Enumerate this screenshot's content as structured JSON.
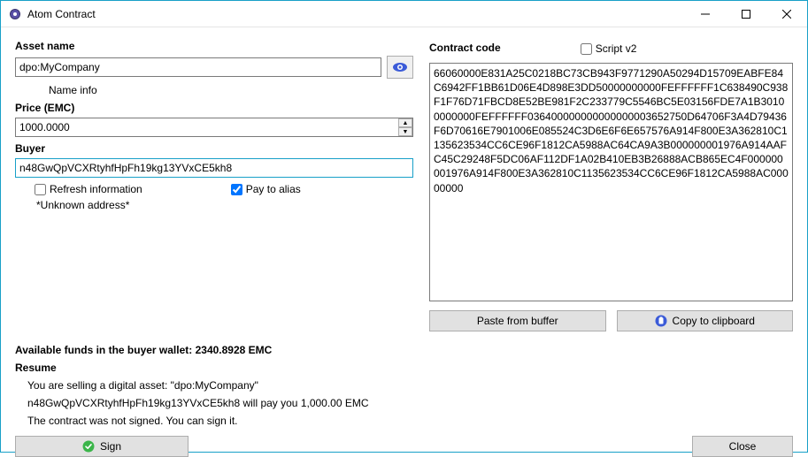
{
  "window": {
    "title": "Atom Contract",
    "minimize": "—",
    "maximize": "□",
    "close": "✕"
  },
  "left": {
    "asset_label": "Asset name",
    "asset_value": "dpo:MyCompany",
    "name_info": "Name info",
    "price_label": "Price (EMC)",
    "price_value": "1000.0000",
    "buyer_label": "Buyer",
    "buyer_value": "n48GwQpVCXRtyhfHpFh19kg13YVxCE5kh8",
    "refresh_label": "Refresh information",
    "pay_alias_label": "Pay to alias",
    "unknown": "*Unknown address*"
  },
  "right": {
    "contract_label": "Contract code",
    "script_label": "Script v2",
    "contract_text": "66060000E831A25C0218BC73CB943F9771290A50294D15709EABFE84C6942FF1BB61D06E4D898E3DD50000000000FEFFFFFF1C638490C938F1F76D71FBCD8E52BE981F2C233779C5546BC5E03156FDE7A1B30100000000FEFFFFFF036400000000000000003652750D64706F3A4D79436F6D70616E7901006E085524C3D6E6F6E657576A914F800E3A362810C1135623534CC6CE96F1812CA5988AC64CA9A3B000000001976A914AAFC45C29248F5DC06AF112DF1A02B410EB3B26888ACB865EC4F000000001976A914F800E3A362810C1135623534CC6CE96F1812CA5988AC00000000",
    "paste_label": "Paste from buffer",
    "copy_label": "Copy to clipboard"
  },
  "bottom": {
    "available": "Available funds in the buyer wallet: 2340.8928 EMC",
    "resume_label": "Resume",
    "line1": "You are selling a digital asset: \"dpo:MyCompany\"",
    "line2": "n48GwQpVCXRtyhfHpFh19kg13YVxCE5kh8 will pay you 1,000.00 EMC",
    "line3": "The contract was not signed. You can sign it.",
    "sign_label": "Sign",
    "close_label": "Close"
  }
}
